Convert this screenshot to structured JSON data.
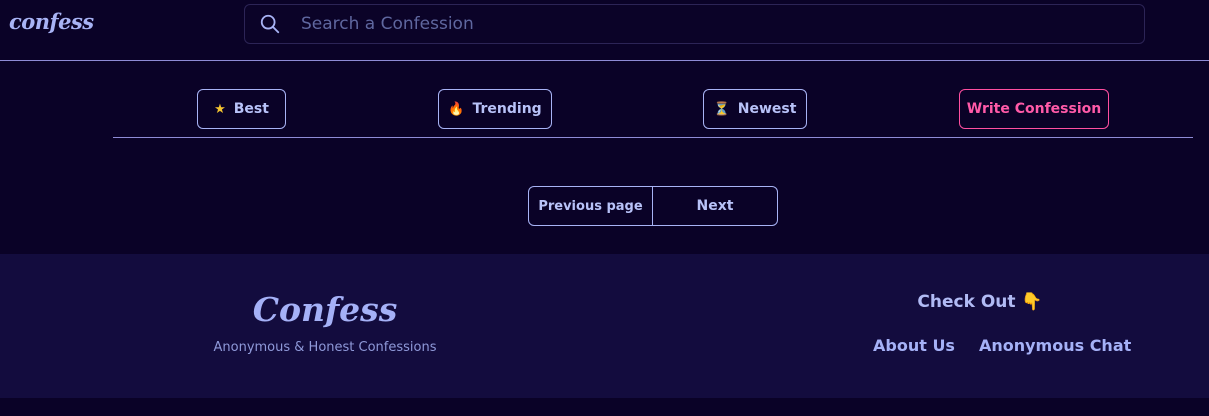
{
  "header": {
    "logo": "confess",
    "search": {
      "placeholder": "Search a Confession",
      "value": ""
    }
  },
  "filters": {
    "best": {
      "icon": "star-icon",
      "glyph": "★",
      "label": "Best"
    },
    "trending": {
      "icon": "fire-icon",
      "glyph": "🔥",
      "label": "Trending"
    },
    "newest": {
      "icon": "hourglass-icon",
      "glyph": "⏳",
      "label": "Newest"
    },
    "write": {
      "label": "Write Confession"
    }
  },
  "pagination": {
    "previous": "Previous page",
    "next": "Next"
  },
  "footer": {
    "brand": "Confess",
    "tagline": "Anonymous & Honest Confessions",
    "check_out": "Check Out 👇",
    "links": [
      "About Us",
      "Anonymous Chat"
    ]
  },
  "colors": {
    "background": "#0a0227",
    "footer_bg": "#130c3e",
    "accent": "#a8b3f5",
    "write_accent": "#ff4fa0"
  }
}
